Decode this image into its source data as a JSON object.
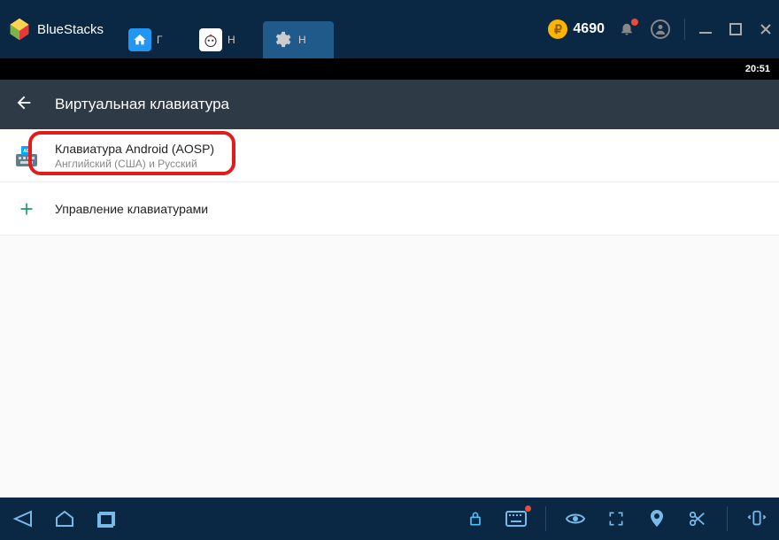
{
  "app": {
    "name": "BlueStacks"
  },
  "tabs": [
    {
      "label": "Г"
    },
    {
      "label": "Н"
    },
    {
      "label": "Н"
    }
  ],
  "coins": {
    "value": "4690"
  },
  "clock": {
    "time": "20:51"
  },
  "settings": {
    "title": "Виртуальная клавиатура",
    "items": [
      {
        "title": "Клавиатура Android (AOSP)",
        "subtitle": "Английский (США) и Русский"
      },
      {
        "title": "Управление клавиатурами"
      }
    ]
  },
  "icons": {
    "coin_glyph": "₽"
  }
}
